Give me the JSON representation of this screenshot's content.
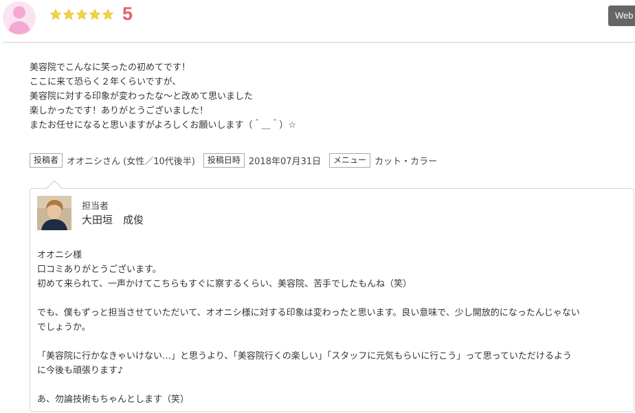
{
  "header": {
    "rating_stars": 5,
    "rating_value": "5",
    "web_button_label": "Web",
    "star_color": "#f5d33a",
    "score_color": "#e1626b"
  },
  "review": {
    "lines": [
      "美容院でこんなに笑ったの初めてです！",
      "ここに来て恐らく２年くらいですが、",
      "美容院に対する印象が変わったな～と改めて思いました",
      "楽しかったです！ありがとうございました！",
      "またお任せになると思いますがよろしくお願いします（＾＿＾）☆"
    ]
  },
  "meta": {
    "poster_tag": "投稿者",
    "poster_value": "オオニシさん (女性／10代後半)",
    "date_tag": "投稿日時",
    "date_value": "2018年07月31日",
    "menu_tag": "メニュー",
    "menu_value": "カット・カラー"
  },
  "reply": {
    "role": "担当者",
    "staff_name": "大田垣　成俊",
    "lines": [
      "オオニシ様",
      "口コミありがとうございます。",
      "初めて来られて、一声かけてこちらもすぐに察するくらい、美容院、苦手でしたもんね（笑）",
      "",
      "でも、僕もずっと担当させていただいて、オオニシ様に対する印象は変わったと思います。良い意味で、少し開放的になったんじゃない",
      "でしょうか。",
      "",
      "「美容院に行かなきゃいけない…」と思うより、「美容院行くの楽しい」「スタッフに元気もらいに行こう」って思っていただけるよう",
      "に今後も頑張ります♪",
      "",
      "あ、勿論技術もちゃんとします（笑）"
    ]
  }
}
